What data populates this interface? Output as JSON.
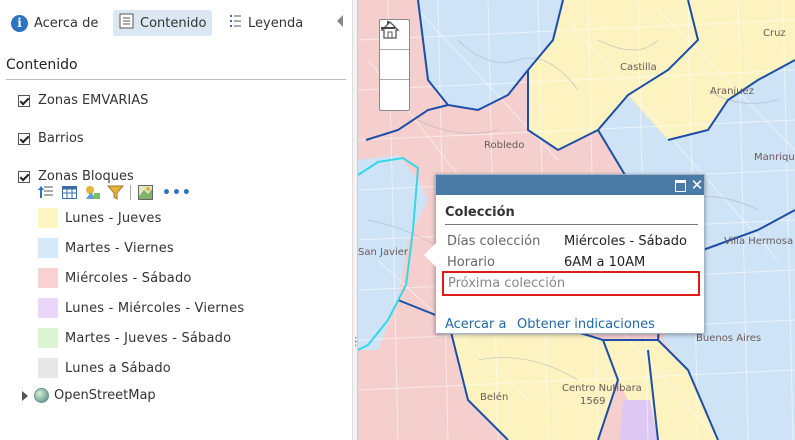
{
  "tabs": {
    "about": "Acerca de",
    "content": "Contenido",
    "legend": "Leyenda"
  },
  "panel_title": "Contenido",
  "layers": [
    {
      "name": "Zonas EMVARIAS",
      "checked": true
    },
    {
      "name": "Barrios",
      "checked": true
    },
    {
      "name": "Zonas Bloques",
      "checked": true
    }
  ],
  "legend": [
    {
      "label": "Lunes - Jueves",
      "color": "#fdf8c3"
    },
    {
      "label": "Martes - Viernes",
      "color": "#d5e9f8"
    },
    {
      "label": "Miércoles - Sábado",
      "color": "#f8d2d2"
    },
    {
      "label": "Lunes - Miércoles - Viernes",
      "color": "#ead6f8"
    },
    {
      "label": "Martes - Jueves - Sábado",
      "color": "#dbf5d2"
    },
    {
      "label": "Lunes a Sábado",
      "color": "#e7e7e7"
    }
  ],
  "basemap": "OpenStreetMap",
  "map": {
    "labels": {
      "castilla": "Castilla",
      "aranjuez": "Aranjuez",
      "manrique": "Manrique",
      "robledo": "Robledo",
      "san_javier": "San Javier",
      "villa_hermosa": "Villa Hermosa",
      "buenos_aires": "Buenos Aires",
      "centro": "Centro Nutibara",
      "belen": "Belén",
      "cruz": "Cruz",
      "num": "1569"
    },
    "colors": {
      "pink": "#f4cfce",
      "blue": "#cfe3f6",
      "yellow": "#fcf3c0",
      "purple": "#dcc8f3",
      "boundary": "#1c4ea8",
      "river": "#35d6e8"
    }
  },
  "popup": {
    "title": "Colección",
    "fields": [
      {
        "label": "Días colección",
        "value": "Miércoles - Sábado"
      },
      {
        "label": "Horario",
        "value": "6AM a 10AM"
      }
    ],
    "next_label": "Próxima colección",
    "zoom_link": "Acercar a",
    "directions_link": "Obtener indicaciones"
  }
}
